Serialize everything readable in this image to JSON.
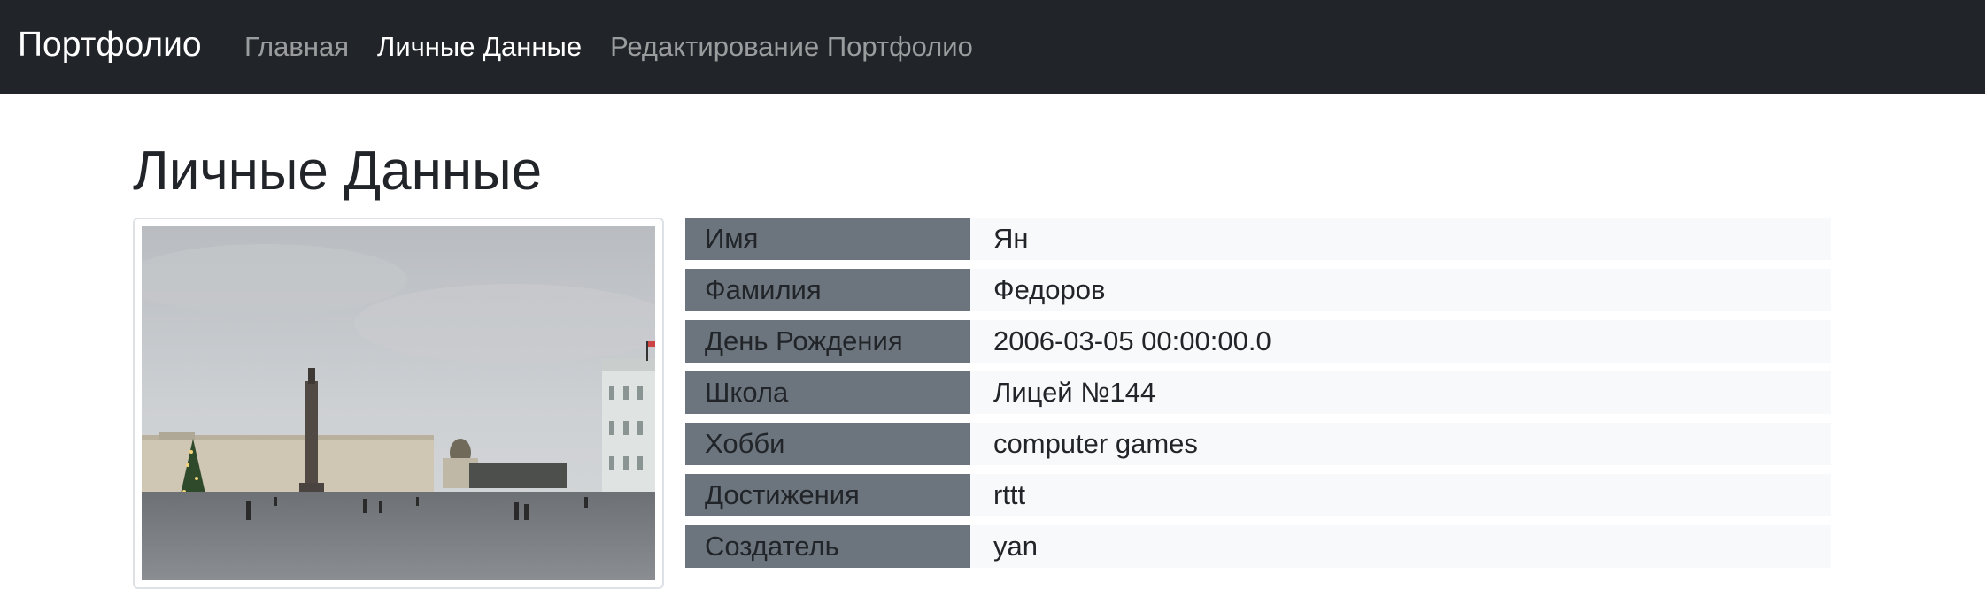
{
  "navbar": {
    "brand": "Портфолио",
    "links": [
      {
        "label": "Главная",
        "active": false
      },
      {
        "label": "Личные Данные",
        "active": true
      },
      {
        "label": "Редактирование Портфолио",
        "active": false
      }
    ]
  },
  "page": {
    "title": "Личные Данные"
  },
  "profile": {
    "rows": [
      {
        "label": "Имя",
        "value": "Ян"
      },
      {
        "label": "Фамилия",
        "value": "Федоров"
      },
      {
        "label": "День Рождения",
        "value": "2006-03-05 00:00:00.0"
      },
      {
        "label": "Школа",
        "value": "Лицей №144"
      },
      {
        "label": "Хобби",
        "value": "computer games"
      },
      {
        "label": "Достижения",
        "value": "rttt"
      },
      {
        "label": "Создатель",
        "value": "yan"
      }
    ]
  },
  "colors": {
    "navbar_bg": "#212529",
    "label_bg": "#6c757d",
    "value_bg": "#f8f9fa"
  }
}
